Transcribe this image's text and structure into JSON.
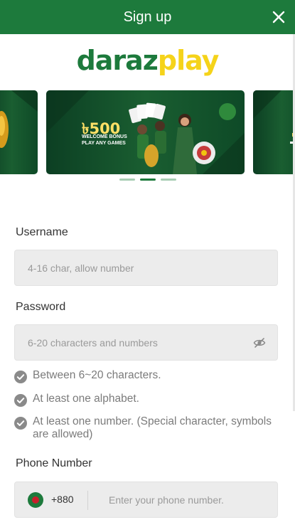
{
  "header": {
    "title": "Sign up",
    "close_icon": "close-icon"
  },
  "logo": {
    "part1": "daraz",
    "part2": "play",
    "color1": "#1d7a3c",
    "color2": "#f5d31a"
  },
  "banner": {
    "amount": "৳500",
    "line1": "WELCOME BONUS",
    "line2": "PLAY ANY GAMES",
    "dots_count": 3,
    "active_dot": 2
  },
  "form": {
    "username": {
      "label": "Username",
      "placeholder": "4-16 char, allow number"
    },
    "password": {
      "label": "Password",
      "placeholder": "6-20 characters and numbers",
      "toggle_icon": "eye-slash-icon"
    },
    "rules": [
      "Between 6~20 characters.",
      "At least one alphabet.",
      "At least one number. (Special character, symbols are allowed)"
    ],
    "phone": {
      "label": "Phone Number",
      "country_code": "+880",
      "placeholder": "Enter your phone number.",
      "flag_icon": "bangladesh-flag-icon"
    }
  },
  "colors": {
    "brand_green": "#1d7a3c",
    "brand_yellow": "#f5d31a",
    "field_bg": "#ececec"
  }
}
